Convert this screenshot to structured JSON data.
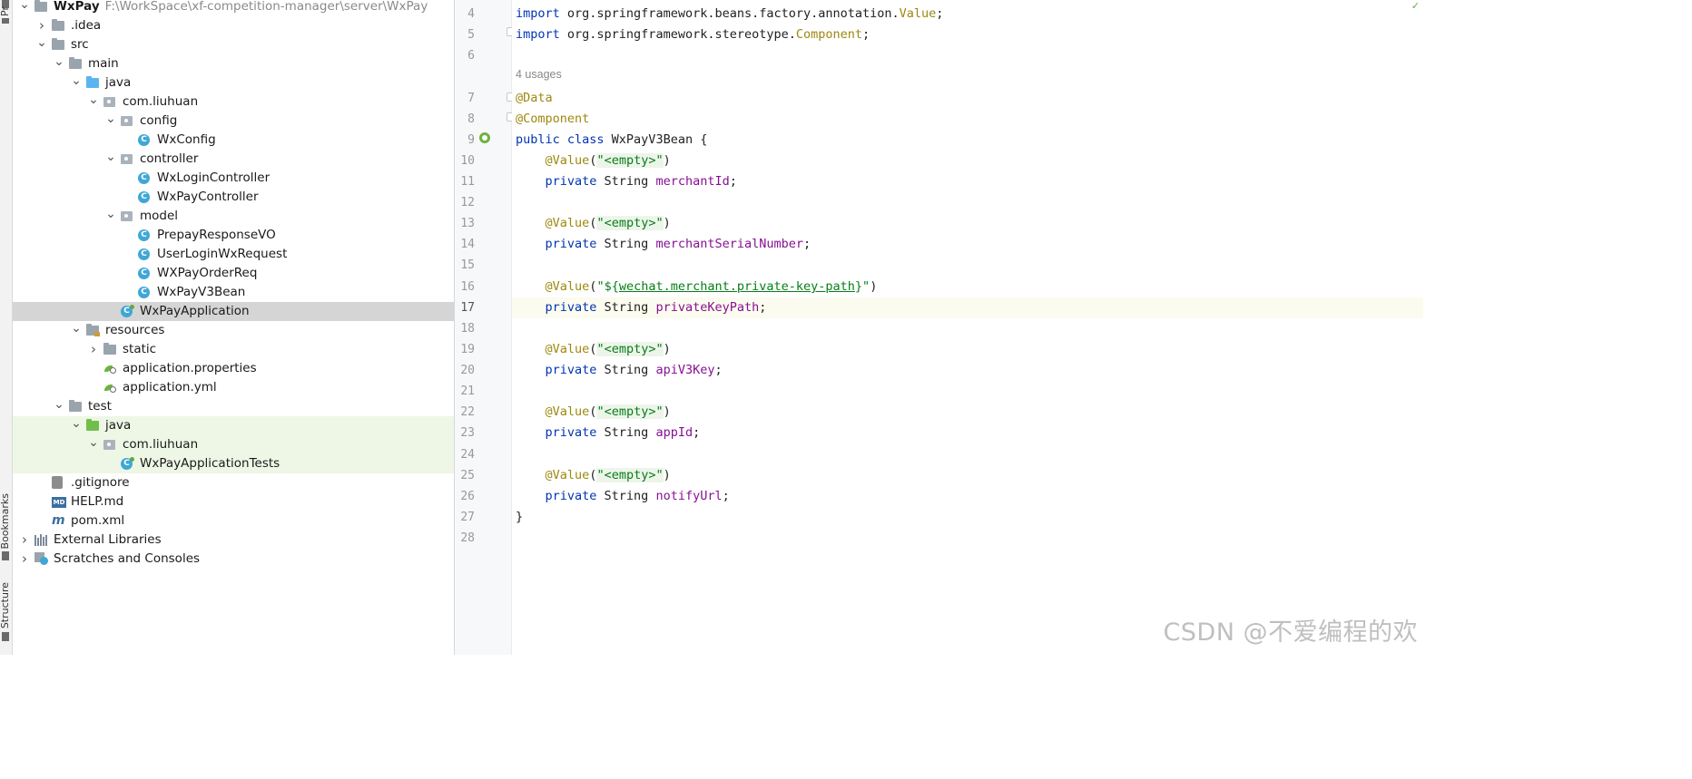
{
  "sidebar_strip": {
    "project_tab": "Pr",
    "bookmarks_tab": "Bookmarks",
    "structure_tab": "Structure"
  },
  "project_tree": [
    {
      "label": "WxPay",
      "path": "F:\\WorkSpace\\xf-competition-manager\\server\\WxPay",
      "icon": "module-folder-icon",
      "indent": 0,
      "arrow": "expanded"
    },
    {
      "label": ".idea",
      "icon": "folder-icon",
      "indent": 1,
      "arrow": "collapsed"
    },
    {
      "label": "src",
      "icon": "folder-icon",
      "indent": 1,
      "arrow": "expanded"
    },
    {
      "label": "main",
      "icon": "folder-icon",
      "indent": 2,
      "arrow": "expanded"
    },
    {
      "label": "java",
      "icon": "source-folder-icon",
      "indent": 3,
      "arrow": "expanded"
    },
    {
      "label": "com.liuhuan",
      "icon": "package-icon",
      "indent": 4,
      "arrow": "expanded"
    },
    {
      "label": "config",
      "icon": "package-icon",
      "indent": 5,
      "arrow": "expanded"
    },
    {
      "label": "WxConfig",
      "icon": "class-icon",
      "indent": 6,
      "arrow": "none"
    },
    {
      "label": "controller",
      "icon": "package-icon",
      "indent": 5,
      "arrow": "expanded"
    },
    {
      "label": "WxLoginController",
      "icon": "class-icon",
      "indent": 6,
      "arrow": "none"
    },
    {
      "label": "WxPayController",
      "icon": "class-icon",
      "indent": 6,
      "arrow": "none"
    },
    {
      "label": "model",
      "icon": "package-icon",
      "indent": 5,
      "arrow": "expanded"
    },
    {
      "label": "PrepayResponseVO",
      "icon": "class-icon",
      "indent": 6,
      "arrow": "none"
    },
    {
      "label": "UserLoginWxRequest",
      "icon": "class-icon",
      "indent": 6,
      "arrow": "none"
    },
    {
      "label": "WXPayOrderReq",
      "icon": "class-icon",
      "indent": 6,
      "arrow": "none"
    },
    {
      "label": "WxPayV3Bean",
      "icon": "class-icon",
      "indent": 6,
      "arrow": "none"
    },
    {
      "label": "WxPayApplication",
      "icon": "spring-app-class-icon",
      "indent": 5,
      "arrow": "none",
      "selected": true
    },
    {
      "label": "resources",
      "icon": "resources-folder-icon",
      "indent": 3,
      "arrow": "expanded"
    },
    {
      "label": "static",
      "icon": "folder-icon",
      "indent": 4,
      "arrow": "collapsed"
    },
    {
      "label": "application.properties",
      "icon": "spring-config-icon",
      "indent": 4,
      "arrow": "none"
    },
    {
      "label": "application.yml",
      "icon": "spring-config-icon",
      "indent": 4,
      "arrow": "none"
    },
    {
      "label": "test",
      "icon": "folder-icon",
      "indent": 2,
      "arrow": "expanded"
    },
    {
      "label": "java",
      "icon": "test-folder-icon",
      "indent": 3,
      "arrow": "expanded",
      "test": true
    },
    {
      "label": "com.liuhuan",
      "icon": "package-icon",
      "indent": 4,
      "arrow": "expanded",
      "test": true
    },
    {
      "label": "WxPayApplicationTests",
      "icon": "spring-app-class-icon",
      "indent": 5,
      "arrow": "none",
      "test": true
    },
    {
      "label": ".gitignore",
      "icon": "gitignore-icon",
      "indent": 1,
      "arrow": "none"
    },
    {
      "label": "HELP.md",
      "icon": "markdown-icon",
      "indent": 1,
      "arrow": "none"
    },
    {
      "label": "pom.xml",
      "icon": "maven-icon",
      "indent": 1,
      "arrow": "none"
    },
    {
      "label": "External Libraries",
      "icon": "libraries-icon",
      "indent": 0,
      "arrow": "collapsed"
    },
    {
      "label": "Scratches and Consoles",
      "icon": "scratches-icon",
      "indent": 0,
      "arrow": "collapsed"
    }
  ],
  "editor": {
    "usages_hint": "4 usages",
    "current_line": 17,
    "lines": [
      {
        "num": "4",
        "tokens": [
          {
            "t": "import ",
            "c": "kw"
          },
          {
            "t": "org.springframework.beans.factory.annotation.",
            "c": ""
          },
          {
            "t": "Value",
            "c": "iface"
          },
          {
            "t": ";",
            "c": ""
          }
        ]
      },
      {
        "num": "5",
        "tokens": [
          {
            "t": "import ",
            "c": "kw"
          },
          {
            "t": "org.springframework.stereotype.",
            "c": ""
          },
          {
            "t": "Component",
            "c": "iface"
          },
          {
            "t": ";",
            "c": ""
          }
        ]
      },
      {
        "num": "6",
        "tokens": []
      },
      {
        "num": "7",
        "tokens": [
          {
            "t": "@Data",
            "c": "ann"
          }
        ]
      },
      {
        "num": "8",
        "tokens": [
          {
            "t": "@Component",
            "c": "ann"
          }
        ]
      },
      {
        "num": "9",
        "tokens": [
          {
            "t": "public class ",
            "c": "kw"
          },
          {
            "t": "WxPayV3Bean {",
            "c": ""
          }
        ]
      },
      {
        "num": "10",
        "tokens": [
          {
            "t": "    ",
            "c": ""
          },
          {
            "t": "@Value",
            "c": "ann"
          },
          {
            "t": "(",
            "c": ""
          },
          {
            "t": "\"<empty>\"",
            "c": "str strbg"
          },
          {
            "t": ")",
            "c": ""
          }
        ]
      },
      {
        "num": "11",
        "tokens": [
          {
            "t": "    ",
            "c": ""
          },
          {
            "t": "private ",
            "c": "kw"
          },
          {
            "t": "String ",
            "c": ""
          },
          {
            "t": "merchantId",
            "c": "field"
          },
          {
            "t": ";",
            "c": ""
          }
        ]
      },
      {
        "num": "12",
        "tokens": []
      },
      {
        "num": "13",
        "tokens": [
          {
            "t": "    ",
            "c": ""
          },
          {
            "t": "@Value",
            "c": "ann"
          },
          {
            "t": "(",
            "c": ""
          },
          {
            "t": "\"<empty>\"",
            "c": "str strbg"
          },
          {
            "t": ")",
            "c": ""
          }
        ]
      },
      {
        "num": "14",
        "tokens": [
          {
            "t": "    ",
            "c": ""
          },
          {
            "t": "private ",
            "c": "kw"
          },
          {
            "t": "String ",
            "c": ""
          },
          {
            "t": "merchantSerialNumber",
            "c": "field"
          },
          {
            "t": ";",
            "c": ""
          }
        ]
      },
      {
        "num": "15",
        "tokens": []
      },
      {
        "num": "16",
        "tokens": [
          {
            "t": "    ",
            "c": ""
          },
          {
            "t": "@Value",
            "c": "ann"
          },
          {
            "t": "(",
            "c": ""
          },
          {
            "t": "\"${",
            "c": "str"
          },
          {
            "t": "wechat.merchant.private-key-path",
            "c": "str und"
          },
          {
            "t": "}\"",
            "c": "str"
          },
          {
            "t": ")",
            "c": ""
          }
        ]
      },
      {
        "num": "17",
        "tokens": [
          {
            "t": "    ",
            "c": ""
          },
          {
            "t": "private ",
            "c": "kw"
          },
          {
            "t": "String ",
            "c": ""
          },
          {
            "t": "privateKeyPath",
            "c": "field"
          },
          {
            "t": ";",
            "c": ""
          }
        ]
      },
      {
        "num": "18",
        "tokens": []
      },
      {
        "num": "19",
        "tokens": [
          {
            "t": "    ",
            "c": ""
          },
          {
            "t": "@Value",
            "c": "ann"
          },
          {
            "t": "(",
            "c": ""
          },
          {
            "t": "\"<empty>\"",
            "c": "str strbg"
          },
          {
            "t": ")",
            "c": ""
          }
        ]
      },
      {
        "num": "20",
        "tokens": [
          {
            "t": "    ",
            "c": ""
          },
          {
            "t": "private ",
            "c": "kw"
          },
          {
            "t": "String ",
            "c": ""
          },
          {
            "t": "apiV3Key",
            "c": "field"
          },
          {
            "t": ";",
            "c": ""
          }
        ]
      },
      {
        "num": "21",
        "tokens": []
      },
      {
        "num": "22",
        "tokens": [
          {
            "t": "    ",
            "c": ""
          },
          {
            "t": "@Value",
            "c": "ann"
          },
          {
            "t": "(",
            "c": ""
          },
          {
            "t": "\"<empty>\"",
            "c": "str strbg"
          },
          {
            "t": ")",
            "c": ""
          }
        ]
      },
      {
        "num": "23",
        "tokens": [
          {
            "t": "    ",
            "c": ""
          },
          {
            "t": "private ",
            "c": "kw"
          },
          {
            "t": "String ",
            "c": ""
          },
          {
            "t": "appId",
            "c": "field"
          },
          {
            "t": ";",
            "c": ""
          }
        ]
      },
      {
        "num": "24",
        "tokens": []
      },
      {
        "num": "25",
        "tokens": [
          {
            "t": "    ",
            "c": ""
          },
          {
            "t": "@Value",
            "c": "ann"
          },
          {
            "t": "(",
            "c": ""
          },
          {
            "t": "\"<empty>\"",
            "c": "str strbg"
          },
          {
            "t": ")",
            "c": ""
          }
        ]
      },
      {
        "num": "26",
        "tokens": [
          {
            "t": "    ",
            "c": ""
          },
          {
            "t": "private ",
            "c": "kw"
          },
          {
            "t": "String ",
            "c": ""
          },
          {
            "t": "notifyUrl",
            "c": "field"
          },
          {
            "t": ";",
            "c": ""
          }
        ]
      },
      {
        "num": "27",
        "tokens": [
          {
            "t": "}",
            "c": ""
          }
        ]
      },
      {
        "num": "28",
        "tokens": []
      }
    ]
  },
  "watermark": "CSDN @不爱编程的欢",
  "colors": {
    "keyword": "#0033b3",
    "annotation": "#9e880d",
    "string": "#067d17",
    "field": "#871094",
    "selection": "#d5d5d5",
    "test_tint": "#eef7e6",
    "current_line": "#fcfbef"
  }
}
